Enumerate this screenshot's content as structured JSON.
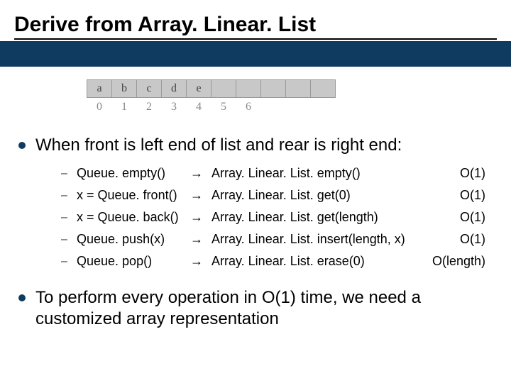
{
  "title": "Derive from Array. Linear. List",
  "array": {
    "cells": [
      "a",
      "b",
      "c",
      "d",
      "e",
      "",
      "",
      "",
      "",
      ""
    ],
    "indices": [
      "0",
      "1",
      "2",
      "3",
      "4",
      "5",
      "6",
      "",
      "",
      ""
    ]
  },
  "bullets": {
    "b1": "When front is left end of list and rear is right end:",
    "b2": "To perform every operation in O(1) time, we need a customized array representation"
  },
  "ops": [
    {
      "left": "Queue. empty()",
      "arrow": "→",
      "right": "Array. Linear. List. empty()",
      "complexity": "O(1)"
    },
    {
      "left": "x = Queue. front()",
      "arrow": "→",
      "right": "Array. Linear. List. get(0)",
      "complexity": "O(1)"
    },
    {
      "left": "x = Queue. back()",
      "arrow": "→",
      "right": "Array. Linear. List. get(length)",
      "complexity": "O(1)"
    },
    {
      "left": "Queue. push(x)",
      "arrow": "→",
      "right": "Array. Linear. List. insert(length, x)",
      "complexity": "O(1)"
    },
    {
      "left": "Queue. pop()",
      "arrow": "→",
      "right": "Array. Linear. List. erase(0)",
      "complexity": "O(length)"
    }
  ]
}
